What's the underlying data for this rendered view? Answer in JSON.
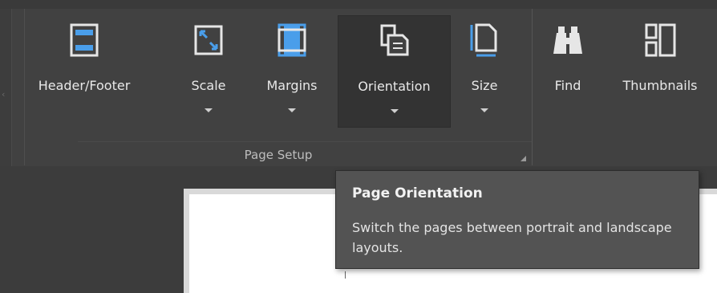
{
  "ribbon": {
    "groups": [
      {
        "label": "Page Setup",
        "buttons": [
          {
            "label": "Header/Footer",
            "icon": "header-footer-icon",
            "dropdown": false
          },
          {
            "label": "Scale",
            "icon": "scale-icon",
            "dropdown": true
          },
          {
            "label": "Margins",
            "icon": "margins-icon",
            "dropdown": true
          },
          {
            "label": "Orientation",
            "icon": "orientation-icon",
            "dropdown": true,
            "active": true
          },
          {
            "label": "Size",
            "icon": "size-icon",
            "dropdown": true
          }
        ]
      },
      {
        "label": "",
        "buttons": [
          {
            "label": "Find",
            "icon": "binoculars-icon"
          },
          {
            "label": "Thumbnails",
            "icon": "thumbnails-icon"
          }
        ]
      }
    ]
  },
  "tooltip": {
    "title": "Page Orientation",
    "description": "Switch the pages between portrait and landscape layouts."
  },
  "colors": {
    "accent": "#4a9eea",
    "ribbon_bg": "#414141",
    "tooltip_bg": "#535353"
  }
}
